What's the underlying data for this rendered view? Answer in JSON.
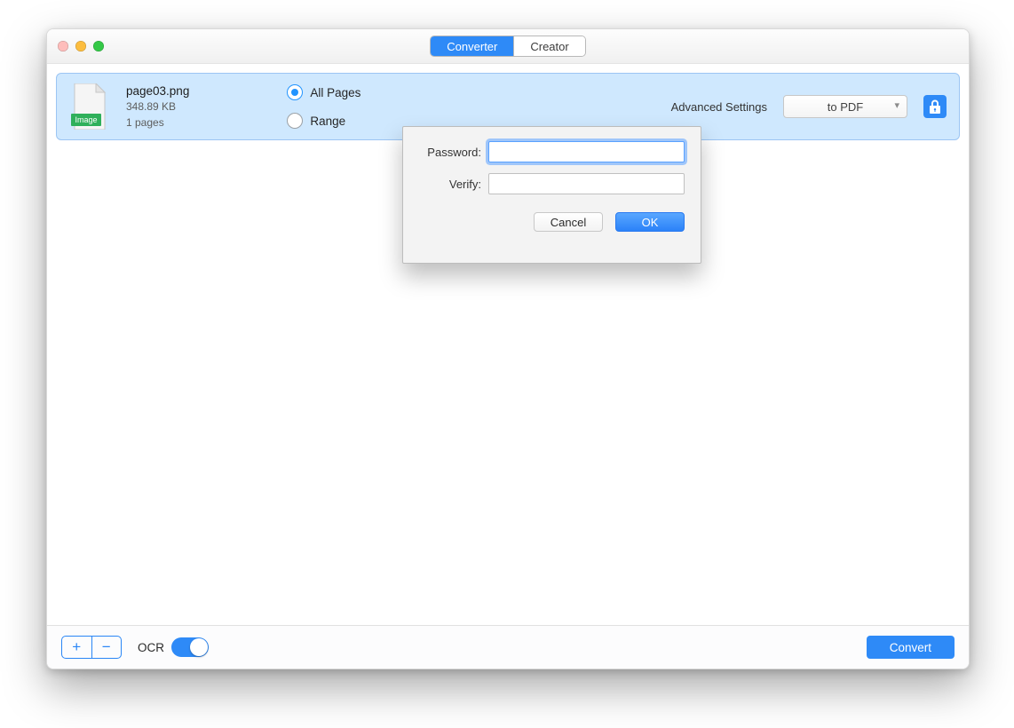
{
  "segmented": {
    "converter": "Converter",
    "creator": "Creator"
  },
  "file": {
    "name": "page03.png",
    "size": "348.89 KB",
    "pages": "1 pages",
    "thumb_tag": "Image"
  },
  "range": {
    "all_pages": "All Pages",
    "range": "Range"
  },
  "row_right": {
    "advanced": "Advanced Settings",
    "format": "to PDF"
  },
  "bottom": {
    "ocr_label": "OCR",
    "convert": "Convert"
  },
  "modal": {
    "password_label": "Password:",
    "verify_label": "Verify:",
    "cancel": "Cancel",
    "ok": "OK",
    "password_value": "",
    "verify_value": ""
  }
}
